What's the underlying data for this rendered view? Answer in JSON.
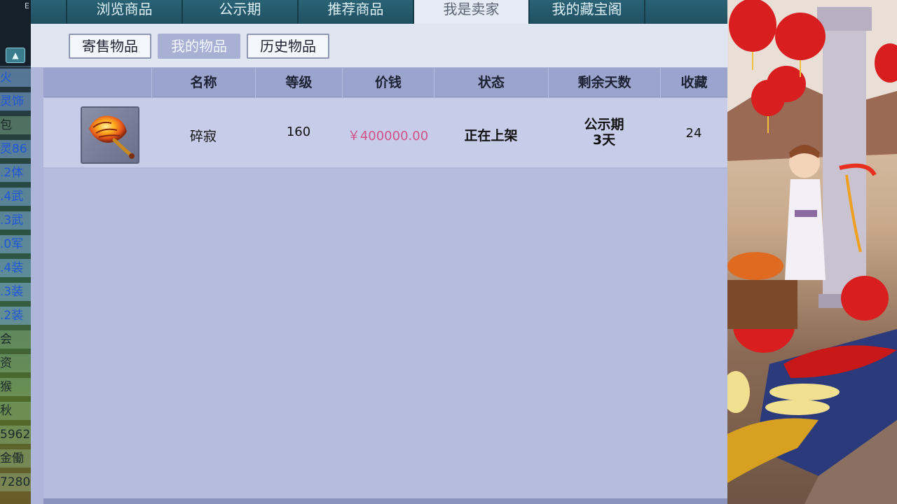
{
  "left_strip": {
    "top_label": "E",
    "lines": [
      {
        "text": "火",
        "style": "blue"
      },
      {
        "text": "灵饰",
        "style": "blue"
      },
      {
        "text": "包",
        "style": "dark"
      },
      {
        "text": "灵86",
        "style": "blue"
      },
      {
        "text": ".2体",
        "style": "blue"
      },
      {
        "text": ".4武",
        "style": "blue"
      },
      {
        "text": ".3武",
        "style": "blue"
      },
      {
        "text": ".0军",
        "style": "blue"
      },
      {
        "text": ".4装",
        "style": "blue"
      },
      {
        "text": ".3装",
        "style": "blue"
      },
      {
        "text": ".2装",
        "style": "blue"
      },
      {
        "text": "会",
        "style": "dark"
      },
      {
        "text": "资",
        "style": "dark"
      },
      {
        "text": "猴",
        "style": "dark"
      },
      {
        "text": "秋",
        "style": "dark"
      },
      {
        "text": "5962",
        "style": "dark"
      },
      {
        "text": "金働",
        "style": "dark"
      },
      {
        "text": "7280",
        "style": "dark"
      }
    ]
  },
  "top_tabs": [
    {
      "label": "",
      "active": false
    },
    {
      "label": "浏览商品",
      "active": false
    },
    {
      "label": "公示期",
      "active": false
    },
    {
      "label": "推荐商品",
      "active": false
    },
    {
      "label": "我是卖家",
      "active": true
    },
    {
      "label": "我的藏宝阁",
      "active": false
    },
    {
      "label": "",
      "active": false
    }
  ],
  "sub_tabs": [
    {
      "label": "寄售物品",
      "active": false
    },
    {
      "label": "我的物品",
      "active": true
    },
    {
      "label": "历史物品",
      "active": false
    }
  ],
  "table": {
    "headers": [
      "",
      "名称",
      "等级",
      "价钱",
      "状态",
      "剩余天数",
      "收藏"
    ],
    "rows": [
      {
        "icon": "weapon-fan-icon",
        "name": "碎寂",
        "level": "160",
        "price": "￥400000.00",
        "status": "正在上架",
        "remaining_line1": "公示期",
        "remaining_line2": "3天",
        "favorites": "24"
      }
    ]
  },
  "colors": {
    "price": "#d0508a",
    "panel_bg": "#aeb7da",
    "header_bg": "#9aa4cc",
    "tabbar_bg": "#1e4a5a"
  }
}
